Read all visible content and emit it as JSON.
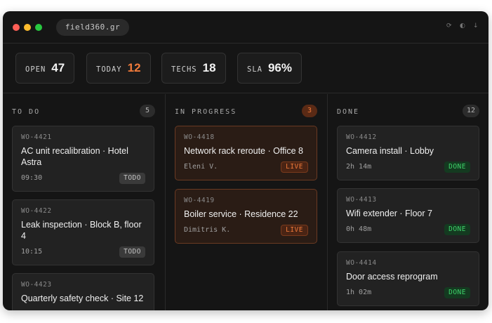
{
  "window": {
    "url": "field360.gr",
    "colors": {
      "background": "#151515",
      "accent": "#f07a3a",
      "done": "#3ed46a"
    },
    "titlebar_icons": [
      "refresh-icon",
      "theme-icon",
      "download-icon"
    ]
  },
  "stats": [
    {
      "label": "OPEN",
      "value": "47"
    },
    {
      "label": "TODAY",
      "value": "12"
    },
    {
      "label": "TECHS",
      "value": "18"
    },
    {
      "label": "SLA",
      "value": "96%"
    }
  ],
  "columns": [
    {
      "title": "TO DO",
      "count": "5",
      "cards": [
        {
          "id": "WO-4421",
          "title": "AC unit recalibration · Hotel Astra",
          "meta": "09:30",
          "badge": "TODO"
        },
        {
          "id": "WO-4422",
          "title": "Leak inspection · Block B, floor 4",
          "meta": "10:15",
          "badge": "TODO"
        },
        {
          "id": "WO-4423",
          "title": "Quarterly safety check · Site 12",
          "meta": "",
          "badge": ""
        }
      ]
    },
    {
      "title": "IN PROGRESS",
      "count": "3",
      "cards": [
        {
          "id": "WO-4418",
          "title": "Network rack reroute · Office 8",
          "meta": "Eleni V.",
          "badge": "LIVE"
        },
        {
          "id": "WO-4419",
          "title": "Boiler service · Residence 22",
          "meta": "Dimitris K.",
          "badge": "LIVE"
        }
      ]
    },
    {
      "title": "DONE",
      "count": "12",
      "cards": [
        {
          "id": "WO-4412",
          "title": "Camera install · Lobby",
          "meta": "2h 14m",
          "badge": "DONE"
        },
        {
          "id": "WO-4413",
          "title": "Wifi extender · Floor 7",
          "meta": "0h 48m",
          "badge": "DONE"
        },
        {
          "id": "WO-4414",
          "title": "Door access reprogram",
          "meta": "1h 02m",
          "badge": "DONE"
        }
      ]
    }
  ]
}
